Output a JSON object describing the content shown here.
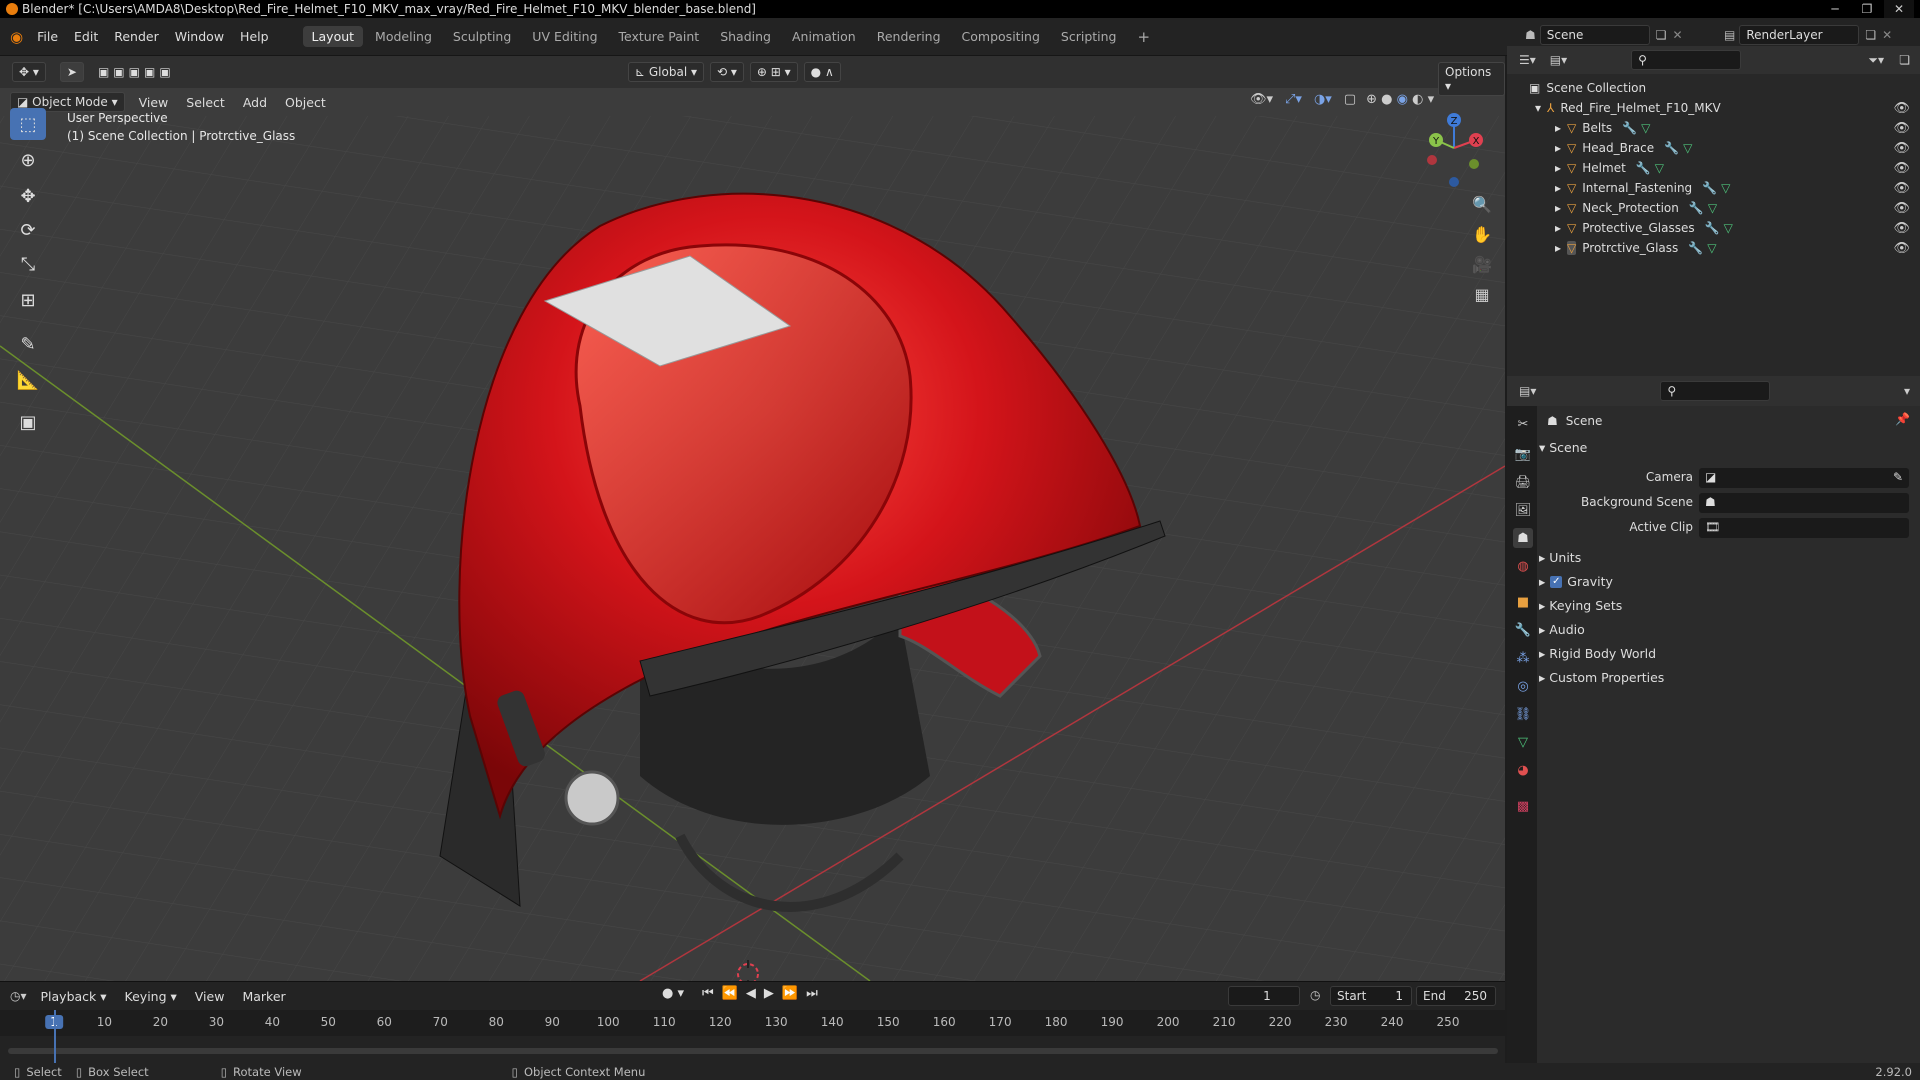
{
  "window": {
    "title": "Blender* [C:\\Users\\AMDA8\\Desktop\\Red_Fire_Helmet_F10_MKV_max_vray/Red_Fire_Helmet_F10_MKV_blender_base.blend]",
    "min": "─",
    "max": "❐",
    "close": "✕"
  },
  "menus": [
    "File",
    "Edit",
    "Render",
    "Window",
    "Help"
  ],
  "workspaces": [
    "Layout",
    "Modeling",
    "Sculpting",
    "UV Editing",
    "Texture Paint",
    "Shading",
    "Animation",
    "Rendering",
    "Compositing",
    "Scripting"
  ],
  "workspace_add": "+",
  "scene_field": "Scene",
  "renderlayer_field": "RenderLayer",
  "viewport": {
    "transform_orientation": "Global",
    "options_label": "Options",
    "mode": "Object Mode",
    "header_menus": [
      "View",
      "Select",
      "Add",
      "Object"
    ],
    "overlay_line1": "User Perspective",
    "overlay_line2": "(1) Scene Collection | Protrctive_Glass"
  },
  "gizmo": {
    "x": "X",
    "y": "Y",
    "z": "Z"
  },
  "outliner": {
    "root": "Scene Collection",
    "collection": "Red_Fire_Helmet_F10_MKV",
    "items": [
      "Belts",
      "Head_Brace",
      "Helmet",
      "Internal_Fastening",
      "Neck_Protection",
      "Protective_Glasses",
      "Protrctive_Glass"
    ]
  },
  "properties": {
    "header": "Scene",
    "section": "Scene",
    "camera_label": "Camera",
    "bg_scene_label": "Background Scene",
    "active_clip_label": "Active Clip",
    "subsections": [
      "Units",
      "Gravity",
      "Keying Sets",
      "Audio",
      "Rigid Body World",
      "Custom Properties"
    ]
  },
  "timeline": {
    "menus": [
      "Playback",
      "Keying",
      "View",
      "Marker"
    ],
    "current_frame": "1",
    "start_label": "Start",
    "start_value": "1",
    "end_label": "End",
    "end_value": "250",
    "ticks": [
      "1",
      "10",
      "20",
      "30",
      "40",
      "50",
      "60",
      "70",
      "80",
      "90",
      "100",
      "110",
      "120",
      "130",
      "140",
      "150",
      "160",
      "170",
      "180",
      "190",
      "200",
      "210",
      "220",
      "230",
      "240",
      "250"
    ]
  },
  "status": {
    "select": "Select",
    "box_select": "Box Select",
    "rotate_view": "Rotate View",
    "context_menu": "Object Context Menu",
    "version": "2.92.0"
  },
  "colors": {
    "accent": "#4772b3",
    "helmet_red": "#d4141a",
    "x_axis": "#e04050",
    "y_axis": "#8bc34a",
    "z_axis": "#3f7bd8"
  }
}
